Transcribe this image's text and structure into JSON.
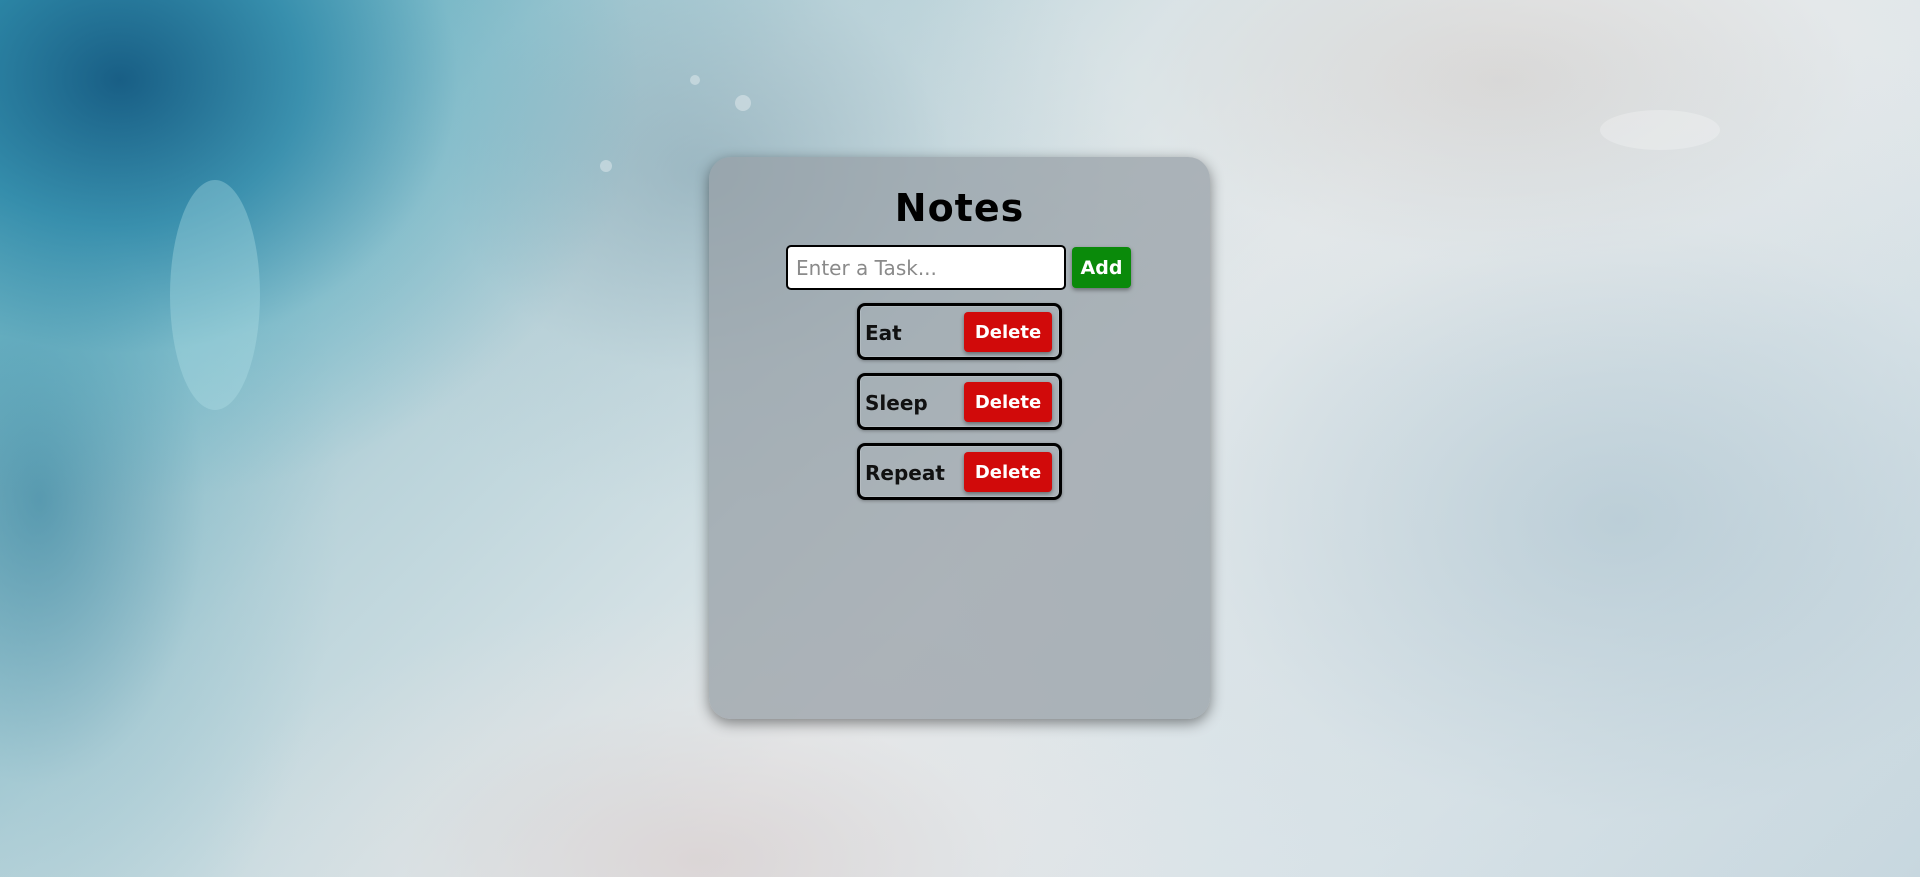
{
  "app": {
    "title": "Notes"
  },
  "input": {
    "placeholder": "Enter a Task...",
    "value": ""
  },
  "add_button": {
    "label": "Add",
    "color": "#0a8a0a"
  },
  "tasks": [
    {
      "label": "Eat",
      "delete_label": "Delete"
    },
    {
      "label": "Sleep",
      "delete_label": "Delete"
    },
    {
      "label": "Repeat",
      "delete_label": "Delete"
    }
  ],
  "colors": {
    "delete": "#d10a0a",
    "card_background": "rgba(150,158,165,0.72)"
  }
}
